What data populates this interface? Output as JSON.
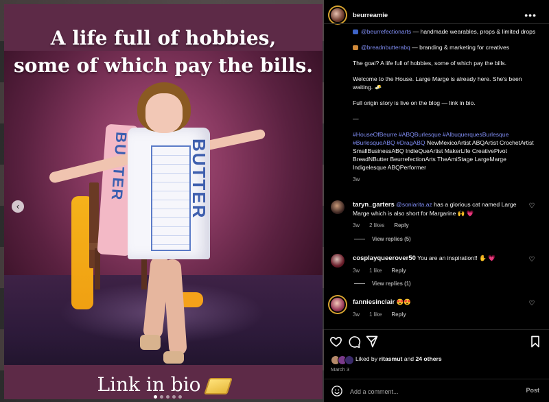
{
  "media": {
    "headline_line1": "A life full of hobbies,",
    "headline_line2": "some of which pay the bills.",
    "cta": "Link in bio",
    "pillow_text": "BUTTER",
    "dress_text": "BUTTER"
  },
  "post": {
    "username": "beurreamie",
    "more_label": "•••"
  },
  "caption": {
    "line1_link": "@beurrefectionarts",
    "line1_text": " — handmade wearables, props & limited drops",
    "line2_link": "@breadnbutterabq",
    "line2_text": " — branding & marketing for creatives",
    "para1": "The goal? A life full of hobbies, some of which pay the bills.",
    "para2": "Welcome to the House. Large Marge is already here. She's been waiting. 🧈",
    "para3": "Full origin story is live on the blog — link in bio.",
    "dash": "—",
    "hashtags_blue": "#HouseOfBeurre #ABQBurlesque #AlbuquerquesBurlesque #BurlesqueABQ #DragABQ",
    "hashtags_white": " NewMexicoArtist ABQArtist CrochetArtist SmallBusinessABQ IndieQueArtist MakerLife CreativePivot BreadNButter BeurrefectionArts TheAmiStage LargeMarge Indigelesque ABQPerformer",
    "time": "3w"
  },
  "comments": [
    {
      "username": "taryn_garters",
      "mention": "@soniarita.az",
      "text": " has a glorious cat named Large Marge which is also short for Margarine 🙌 💗",
      "time": "3w",
      "likes": "2 likes",
      "reply": "Reply",
      "view_replies": "View replies (5)"
    },
    {
      "username": "cosplayqueerover50",
      "text": " You are an inspiration!! ✋ 💗",
      "time": "3w",
      "likes": "1 like",
      "reply": "Reply",
      "view_replies": "View replies (1)"
    },
    {
      "username": "fanniesinclair",
      "text": " 😍😍",
      "time": "3w",
      "likes": "1 like",
      "reply": "Reply"
    }
  ],
  "likes": {
    "prefix": "Liked by ",
    "user": "ritasmut",
    "middle": " and ",
    "others": "24 others"
  },
  "date": "March 3",
  "comment_bar": {
    "placeholder": "Add a comment...",
    "post_label": "Post"
  },
  "colors": {
    "link": "#7f8cf2",
    "panel_bg": "#000000",
    "story_ring": "#d8a430",
    "heart_red": "#ed4956"
  }
}
